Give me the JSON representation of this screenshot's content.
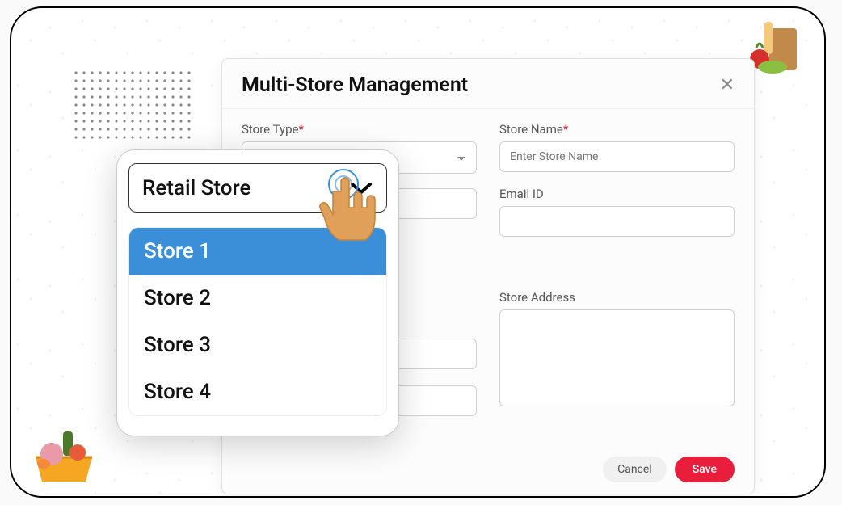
{
  "modal": {
    "title": "Multi-Store Management",
    "labels": {
      "store_type": "Store Type",
      "store_name": "Store Name",
      "email_id": "Email ID",
      "store_address": "Store Address"
    },
    "placeholders": {
      "store_name": "Enter Store Name"
    },
    "buttons": {
      "cancel": "Cancel",
      "save": "Save"
    }
  },
  "popup": {
    "selected": "Retail Store",
    "options": [
      "Store 1",
      "Store 2",
      "Store 3",
      "Store 4"
    ],
    "active_index": 0
  }
}
